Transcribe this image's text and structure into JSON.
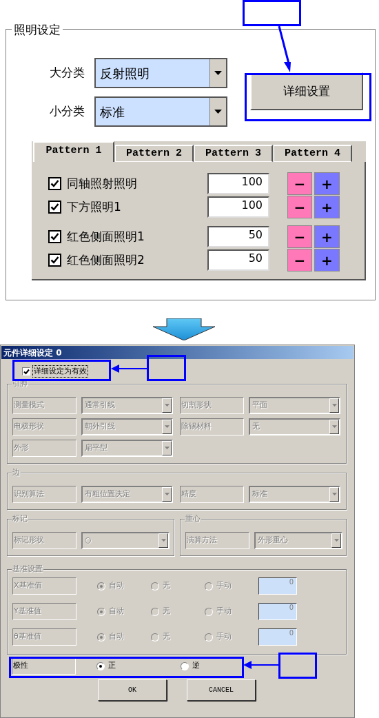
{
  "lighting_panel": {
    "title": "照明设定",
    "fields": [
      {
        "label": "大分类",
        "value": "反射照明"
      },
      {
        "label": "小分类",
        "value": "标准"
      }
    ],
    "detail_button": "详细设置",
    "tabs": [
      {
        "label": "Pattern 1",
        "selected": true
      },
      {
        "label": "Pattern 2",
        "selected": false
      },
      {
        "label": "Pattern 3",
        "selected": false
      },
      {
        "label": "Pattern 4",
        "selected": false
      }
    ],
    "light_groups": [
      {
        "lights": [
          {
            "label": "同轴照射照明",
            "checked": true,
            "value": "100",
            "minus": "−",
            "plus": "+"
          },
          {
            "label": "下方照明1",
            "checked": true,
            "value": "100",
            "minus": "−",
            "plus": "+"
          }
        ]
      },
      {
        "lights": [
          {
            "label": "红色侧面照明1",
            "checked": true,
            "value": "50",
            "minus": "−",
            "plus": "+"
          },
          {
            "label": "红色侧面照明2",
            "checked": true,
            "value": "50",
            "minus": "−",
            "plus": "+"
          }
        ]
      }
    ]
  },
  "dialog": {
    "title": "元件详细设定 0",
    "enable_checkbox": {
      "label": "详细设定为有效",
      "checked": true
    },
    "sections": [
      {
        "kind": "group",
        "title": "引脚",
        "disabled": true,
        "fields": [
          {
            "label": "测量模式",
            "value": "通常引线"
          },
          {
            "label": "切割形状",
            "value": "平面"
          },
          {
            "label": "电极形状",
            "value": "朝外引线"
          },
          {
            "label": "除锡材料",
            "value": "无"
          },
          {
            "label": "外形",
            "value": "扁平型"
          }
        ]
      },
      {
        "kind": "group",
        "title": "边",
        "disabled": true,
        "fields": [
          {
            "label": "识别算法",
            "value": "有粗位置决定"
          },
          {
            "label": "精度",
            "value": "标准"
          }
        ]
      },
      {
        "kind": "pair",
        "groups": [
          {
            "title": "标记",
            "disabled": true,
            "fields": [
              {
                "label": "标记形状",
                "value": "○"
              }
            ]
          },
          {
            "title": "重心",
            "disabled": true,
            "fields": [
              {
                "label": "演算方法",
                "value": "外形重心"
              }
            ]
          }
        ]
      }
    ],
    "reference": {
      "title": "基准设置",
      "disabled": true,
      "rows": [
        {
          "label": "X基准值",
          "options": [
            {
              "label": "自动",
              "selected": true
            },
            {
              "label": "无",
              "selected": false
            },
            {
              "label": "手动",
              "selected": false
            }
          ],
          "value": "0"
        },
        {
          "label": "Y基准值",
          "options": [
            {
              "label": "自动",
              "selected": true
            },
            {
              "label": "无",
              "selected": false
            },
            {
              "label": "手动",
              "selected": false
            }
          ],
          "value": "0"
        },
        {
          "label": "θ基准值",
          "options": [
            {
              "label": "自动",
              "selected": true
            },
            {
              "label": "无",
              "selected": false
            },
            {
              "label": "手动",
              "selected": false
            }
          ],
          "value": "0"
        }
      ]
    },
    "polarity": {
      "label": "极性",
      "options": [
        {
          "label": "正",
          "selected": true
        },
        {
          "label": "逆",
          "selected": false
        }
      ]
    },
    "buttons": [
      "OK",
      "CANCEL"
    ]
  }
}
